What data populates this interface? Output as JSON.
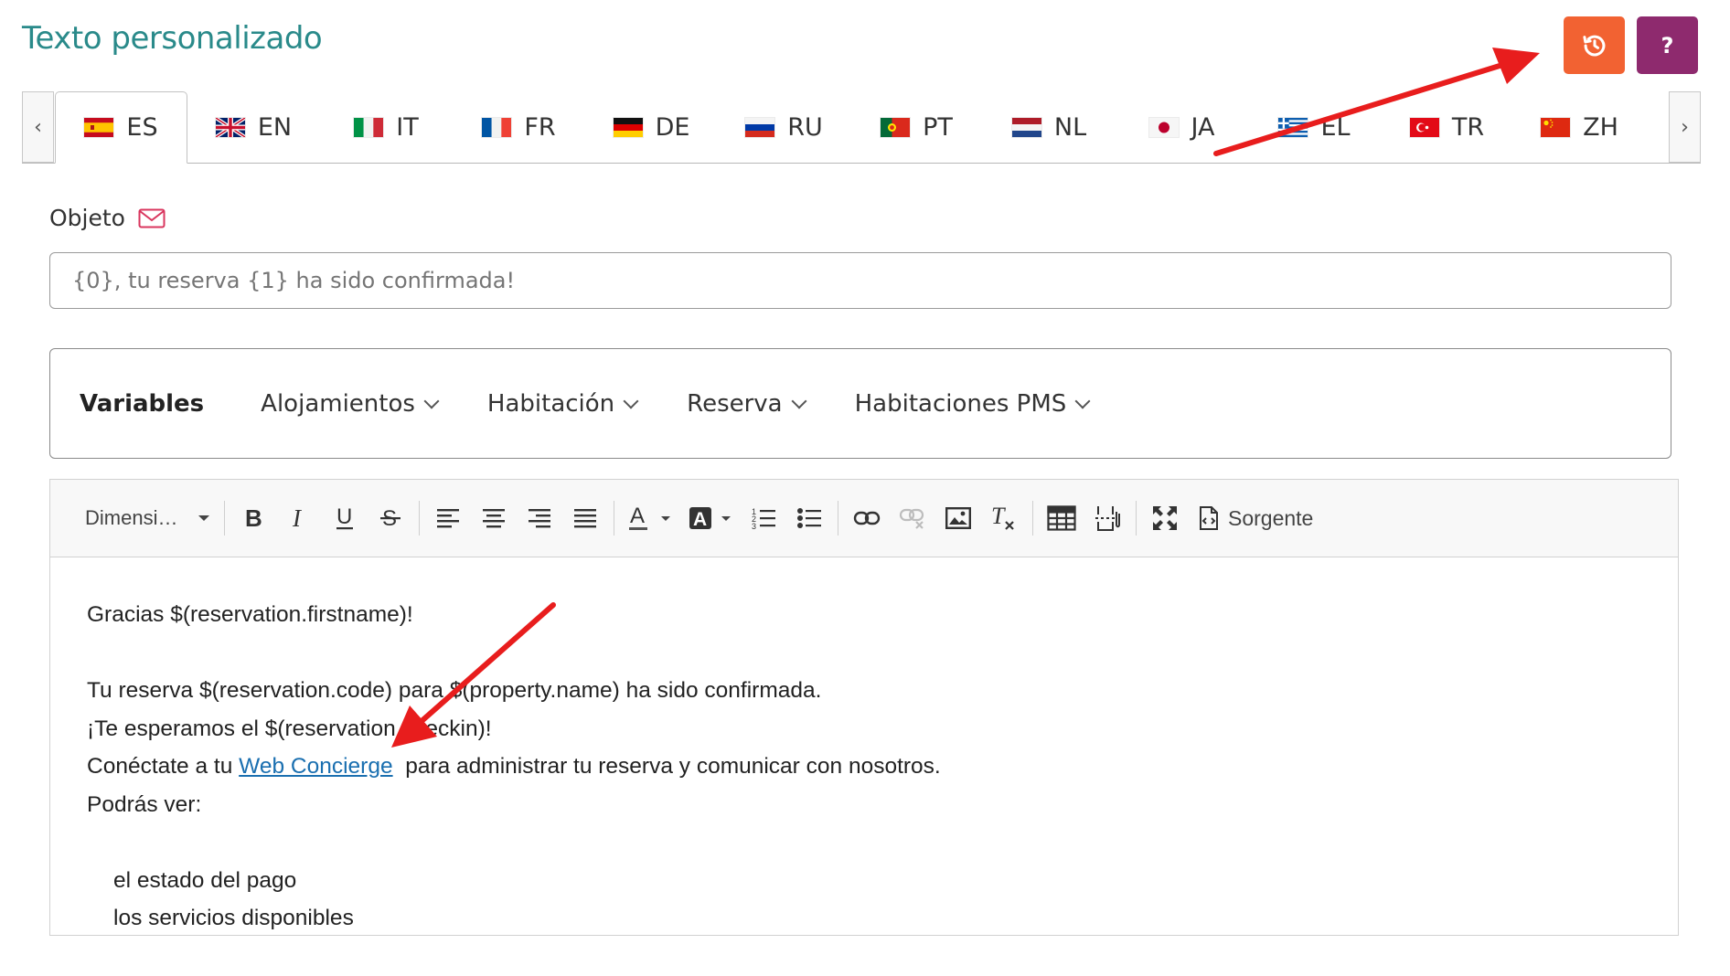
{
  "header": {
    "title": "Texto personalizado",
    "history_icon": "history-icon",
    "help_label": "?"
  },
  "language_tabs": [
    {
      "code": "ES",
      "flag": "spain-flag",
      "active": true
    },
    {
      "code": "EN",
      "flag": "uk-flag",
      "active": false
    },
    {
      "code": "IT",
      "flag": "italy-flag",
      "active": false
    },
    {
      "code": "FR",
      "flag": "france-flag",
      "active": false
    },
    {
      "code": "DE",
      "flag": "germany-flag",
      "active": false
    },
    {
      "code": "RU",
      "flag": "russia-flag",
      "active": false
    },
    {
      "code": "PT",
      "flag": "portugal-flag",
      "active": false
    },
    {
      "code": "NL",
      "flag": "netherlands-flag",
      "active": false
    },
    {
      "code": "JA",
      "flag": "japan-flag",
      "active": false
    },
    {
      "code": "EL",
      "flag": "greece-flag",
      "active": false
    },
    {
      "code": "TR",
      "flag": "turkey-flag",
      "active": false
    },
    {
      "code": "ZH",
      "flag": "china-flag",
      "active": false
    }
  ],
  "subject": {
    "label": "Objeto",
    "placeholder": "{0}, tu reserva {1} ha sido confirmada!"
  },
  "variables": {
    "title": "Variables",
    "menus": [
      "Alojamientos",
      "Habitación",
      "Reserva",
      "Habitaciones PMS"
    ]
  },
  "editor": {
    "font_size_label": "Dimensi…",
    "source_label": "Sorgente",
    "content": {
      "line1": "Gracias $(reservation.firstname)!",
      "line2": "Tu reserva $(reservation.code) para $(property.name) ha sido confirmada.",
      "line3": "¡Te esperamos el $(reservation.checkin)!",
      "line4_pre": "Conéctate a tu ",
      "line4_link": "Web Concierge",
      "line4_post": "  para administrar tu reserva y comunicar con nosotros.",
      "line5": "Podrás ver:",
      "list_item1": "el estado del pago",
      "list_item2": "los servicios disponibles"
    }
  },
  "colors": {
    "title": "#2a8a8a",
    "history_button": "#f26232",
    "help_button": "#8e2a6e",
    "annotation_arrow": "#e81d1d",
    "link": "#1a6fb0"
  }
}
